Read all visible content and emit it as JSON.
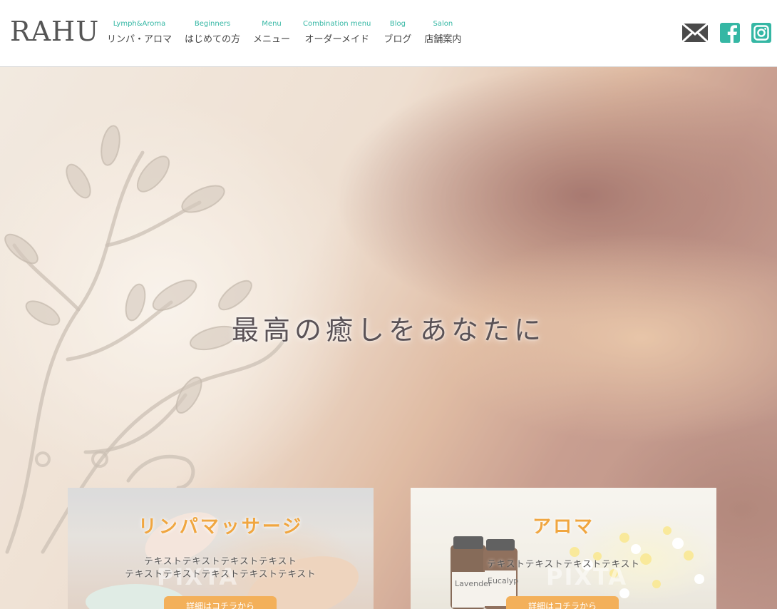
{
  "header": {
    "logo": "RAHU",
    "nav": [
      {
        "en": "Lymph&Aroma",
        "jp": "リンパ・アロマ"
      },
      {
        "en": "Beginners",
        "jp": "はじめての方"
      },
      {
        "en": "Menu",
        "jp": "メニュー"
      },
      {
        "en": "Combination menu",
        "jp": "オーダーメイド"
      },
      {
        "en": "Blog",
        "jp": "ブログ"
      },
      {
        "en": "Salon",
        "jp": "店舗案内"
      }
    ],
    "social_icons": [
      "mail-icon",
      "facebook-icon",
      "instagram-icon"
    ],
    "accent_color": "#35b7a4"
  },
  "hero": {
    "title": "最高の癒しをあなたに"
  },
  "cards": [
    {
      "title": "リンパマッサージ",
      "text_lines": [
        "テキストテキストテキストテキスト",
        "テキストテキストテキストテキストテキスト"
      ],
      "button": "詳細はコチラから",
      "watermark": "PIXTA"
    },
    {
      "title": "アロマ",
      "text_lines": [
        "テキストテキストテキストテキスト"
      ],
      "button": "詳細はコチラから",
      "watermark": "PIXTA",
      "bottle_labels": [
        "Lavender",
        "Eucalyp"
      ]
    }
  ],
  "colors": {
    "card_title": "#f0a640",
    "button": "#f3b05a"
  }
}
